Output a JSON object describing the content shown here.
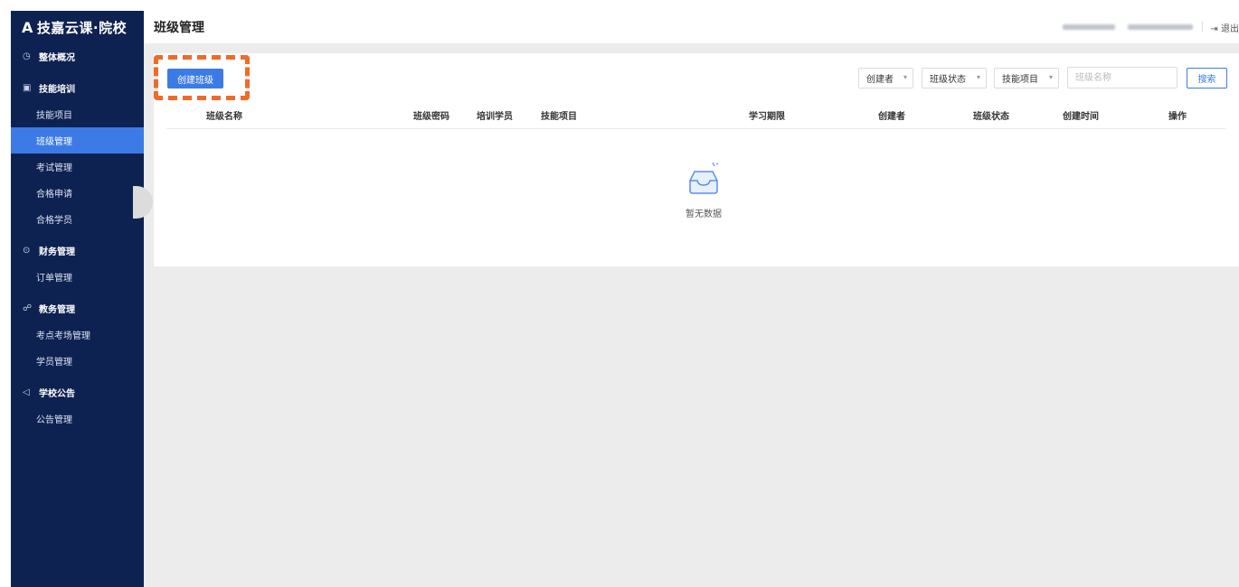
{
  "brand": {
    "mark": "A",
    "name": "技嘉云课·院校"
  },
  "sidebar": {
    "groups": [
      {
        "icon": "clock-icon",
        "glyph": "◷",
        "title": "整体概况",
        "items": []
      },
      {
        "icon": "training-icon",
        "glyph": "▣",
        "title": "技能培训",
        "items": [
          "技能项目",
          "班级管理",
          "考试管理",
          "合格申请",
          "合格学员"
        ]
      },
      {
        "icon": "finance-icon",
        "glyph": "⊙",
        "title": "财务管理",
        "items": [
          "订单管理"
        ]
      },
      {
        "icon": "users-icon",
        "glyph": "☍",
        "title": "教务管理",
        "items": [
          "考点考场管理",
          "学员管理"
        ]
      },
      {
        "icon": "speaker-icon",
        "glyph": "◁",
        "title": "学校公告",
        "items": [
          "公告管理"
        ]
      }
    ],
    "active_item": "班级管理"
  },
  "header": {
    "title": "班级管理",
    "logout_label": "退出",
    "logout_icon": "logout-icon"
  },
  "toolbar": {
    "create_label": "创建班级",
    "filters": [
      "创建者",
      "班级状态",
      "技能项目"
    ],
    "search_placeholder": "班级名称",
    "search_label": "搜索"
  },
  "table": {
    "columns": [
      "班级名称",
      "班级密码",
      "培训学员",
      "技能项目",
      "学习期限",
      "创建者",
      "班级状态",
      "创建时间",
      "操作"
    ]
  },
  "empty_text": "暂无数据",
  "colors": {
    "sidebar": "#0e2252",
    "accent": "#3c7be6",
    "highlight": "#f06a2a",
    "background": "#ececec"
  }
}
